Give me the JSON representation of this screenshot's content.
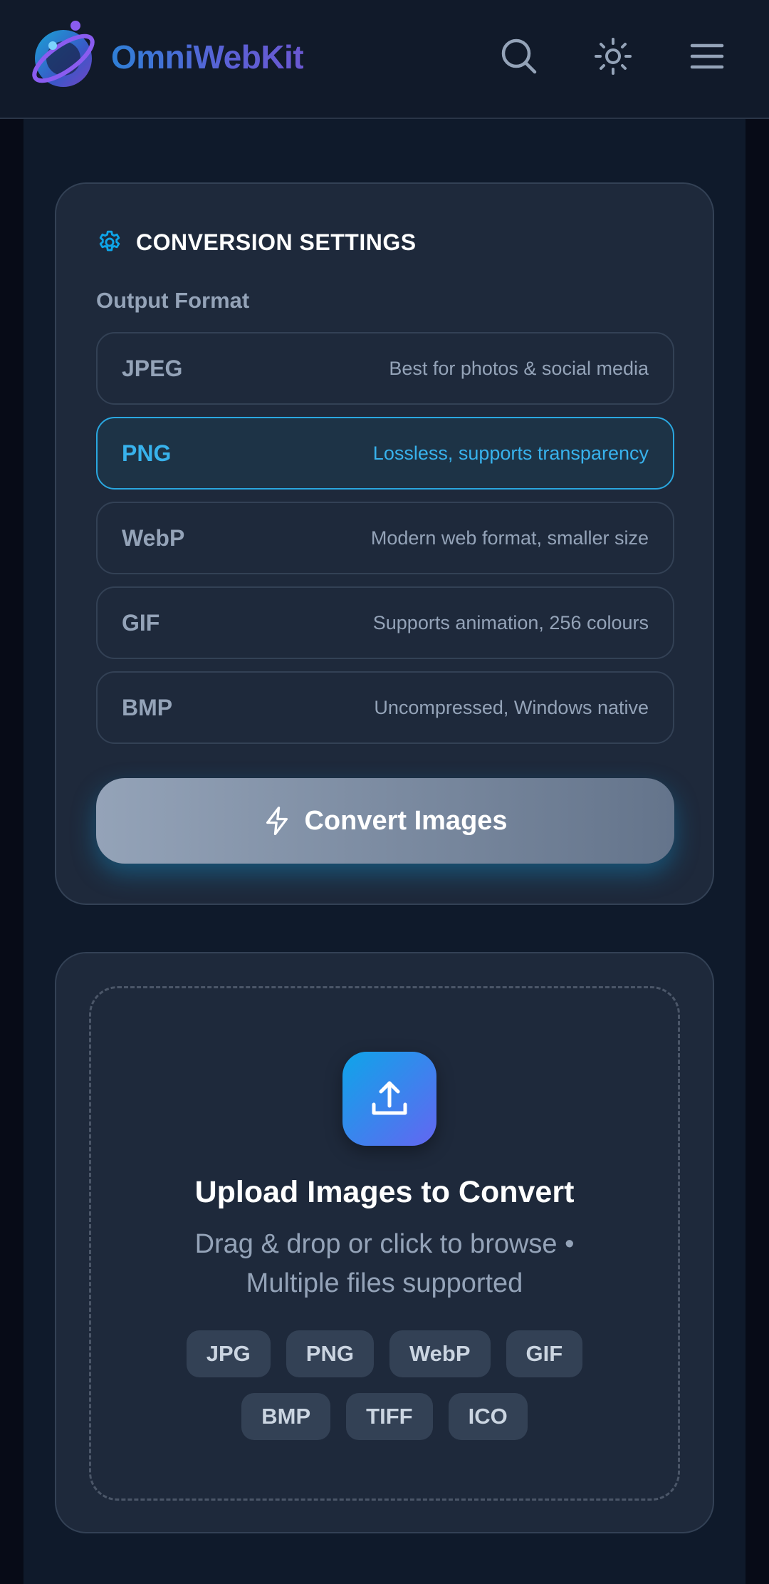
{
  "header": {
    "brand_name": "OmniWebKit",
    "icons": [
      "search-icon",
      "sun-icon",
      "hamburger-menu-icon"
    ]
  },
  "settings": {
    "title": "CONVERSION SETTINGS",
    "icon": "gear-icon",
    "output_label": "Output Format",
    "selected_format": "PNG",
    "formats": [
      {
        "name": "JPEG",
        "desc": "Best for photos & social media"
      },
      {
        "name": "PNG",
        "desc": "Lossless, supports transparency"
      },
      {
        "name": "WebP",
        "desc": "Modern web format, smaller size"
      },
      {
        "name": "GIF",
        "desc": "Supports animation, 256 colours"
      },
      {
        "name": "BMP",
        "desc": "Uncompressed, Windows native"
      }
    ],
    "convert_label": "Convert Images",
    "convert_icon": "lightning-icon"
  },
  "upload": {
    "icon": "upload-icon",
    "title": "Upload Images to Convert",
    "subtitle": "Drag & drop or click to browse • Multiple files supported",
    "chips_row1": [
      "JPG",
      "PNG",
      "WebP",
      "GIF"
    ],
    "chips_row2": [
      "BMP",
      "TIFF",
      "ICO"
    ]
  },
  "colors": {
    "accent": "#38b2ec",
    "background": "#0f1a2b",
    "card": "#1e293b"
  }
}
